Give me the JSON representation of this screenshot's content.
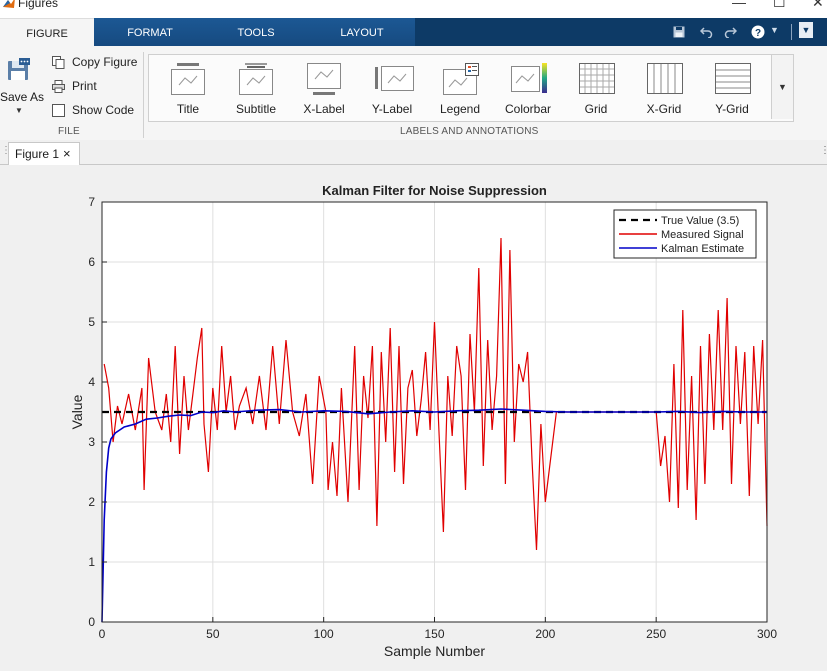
{
  "window": {
    "title": "Figures",
    "minimize_glyph": "—",
    "restore_glyph": "☐",
    "close_glyph": "✕"
  },
  "ribbon": {
    "tabs": [
      "FIGURE",
      "FORMAT",
      "TOOLS",
      "LAYOUT"
    ],
    "active_tab": "FIGURE",
    "file": {
      "section_label": "FILE",
      "save_as": "Save As",
      "copy_figure": "Copy Figure",
      "print": "Print",
      "show_code": "Show Code"
    },
    "annotations": {
      "section_label": "LABELS AND ANNOTATIONS",
      "buttons": [
        "Title",
        "Subtitle",
        "X-Label",
        "Y-Label",
        "Legend",
        "Colorbar",
        "Grid",
        "X-Grid",
        "Y-Grid"
      ]
    },
    "icons": [
      "save-icon",
      "undo-icon",
      "redo-icon",
      "help-icon",
      "dropdown-icon"
    ]
  },
  "doc_tabs": [
    {
      "label": "Figure 1",
      "close": "×"
    }
  ],
  "colors": {
    "ribbon_bar": "#1c5894",
    "measured": "#e00000",
    "estimate": "#0000c8",
    "true_value": "#000000"
  },
  "chart_data": {
    "type": "line",
    "title": "Kalman Filter for Noise Suppression",
    "xlabel": "Sample Number",
    "ylabel": "Value",
    "xlim": [
      0,
      300
    ],
    "ylim": [
      0,
      7
    ],
    "xticks": [
      0,
      50,
      100,
      150,
      200,
      250,
      300
    ],
    "yticks": [
      0,
      1,
      2,
      3,
      4,
      5,
      6,
      7
    ],
    "grid": true,
    "legend_position": "top-right",
    "series": [
      {
        "name": "True Value (3.5)",
        "style": "dashed",
        "color": "#000000",
        "x": [
          0,
          300
        ],
        "y": [
          3.5,
          3.5
        ]
      },
      {
        "name": "Measured Signal",
        "style": "solid",
        "color": "#e00000",
        "x": [
          1,
          3,
          5,
          7,
          9,
          12,
          15,
          18,
          19,
          21,
          24,
          27,
          29,
          31,
          33,
          35,
          37,
          39,
          41,
          43,
          45,
          46,
          48,
          50,
          52,
          54,
          56,
          58,
          60,
          62,
          65,
          68,
          71,
          74,
          77,
          80,
          83,
          86,
          89,
          92,
          95,
          98,
          101,
          102,
          104,
          106,
          108,
          111,
          114,
          116,
          118,
          120,
          122,
          124,
          126,
          128,
          130,
          132,
          134,
          136,
          138,
          140,
          142,
          144,
          146,
          148,
          150,
          152,
          154,
          156,
          158,
          160,
          162,
          164,
          166,
          168,
          170,
          172,
          174,
          176,
          178,
          180,
          182,
          184,
          186,
          188,
          190,
          192,
          194,
          196,
          198,
          200,
          205,
          210,
          215,
          220,
          225,
          230,
          235,
          240,
          245,
          250,
          252,
          254,
          256,
          258,
          260,
          262,
          264,
          266,
          268,
          270,
          272,
          274,
          276,
          278,
          280,
          282,
          284,
          286,
          288,
          290,
          292,
          294,
          296,
          298,
          300
        ],
        "y": [
          4.3,
          3.9,
          3.0,
          3.6,
          3.3,
          3.8,
          3.2,
          3.9,
          2.2,
          4.4,
          3.5,
          3.2,
          3.8,
          3.0,
          4.6,
          2.8,
          4.1,
          3.2,
          3.8,
          4.4,
          4.9,
          3.3,
          2.5,
          3.9,
          3.2,
          4.6,
          3.5,
          4.1,
          3.2,
          3.6,
          3.9,
          3.3,
          4.1,
          3.2,
          4.6,
          3.3,
          4.7,
          3.5,
          3.1,
          3.8,
          2.3,
          4.1,
          3.5,
          2.2,
          3.0,
          2.1,
          3.9,
          2.0,
          4.6,
          2.2,
          4.1,
          3.4,
          4.6,
          1.6,
          4.5,
          3.0,
          4.9,
          2.5,
          4.6,
          2.3,
          3.9,
          4.2,
          3.1,
          3.7,
          4.5,
          3.2,
          5.0,
          3.2,
          1.5,
          4.1,
          3.1,
          4.6,
          4.1,
          2.2,
          4.8,
          3.5,
          5.9,
          2.6,
          4.7,
          3.2,
          4.1,
          6.4,
          2.3,
          6.2,
          3.0,
          4.3,
          4.0,
          4.5,
          2.7,
          1.2,
          3.3,
          2.0,
          3.5,
          3.5,
          3.5,
          3.5,
          3.5,
          3.5,
          3.5,
          3.5,
          3.5,
          3.5,
          2.6,
          3.1,
          2.0,
          4.3,
          1.9,
          5.2,
          2.2,
          4.1,
          1.7,
          4.6,
          2.3,
          4.8,
          3.2,
          5.2,
          3.2,
          5.4,
          2.3,
          4.6,
          3.3,
          4.5,
          2.1,
          4.6,
          3.3,
          4.7,
          1.6
        ]
      },
      {
        "name": "Kalman Estimate",
        "style": "solid",
        "color": "#0000c8",
        "x": [
          0,
          1,
          2,
          3,
          4,
          6,
          8,
          10,
          15,
          20,
          25,
          30,
          35,
          40,
          45,
          50,
          55,
          60,
          70,
          80,
          90,
          100,
          110,
          120,
          130,
          140,
          150,
          160,
          170,
          180,
          190,
          200,
          210,
          220,
          230,
          240,
          250,
          260,
          270,
          280,
          290,
          300
        ],
        "y": [
          0,
          1.7,
          2.5,
          2.9,
          3.05,
          3.15,
          3.2,
          3.25,
          3.3,
          3.38,
          3.4,
          3.43,
          3.45,
          3.44,
          3.5,
          3.49,
          3.52,
          3.5,
          3.53,
          3.54,
          3.5,
          3.52,
          3.51,
          3.47,
          3.5,
          3.52,
          3.5,
          3.52,
          3.53,
          3.55,
          3.53,
          3.51,
          3.5,
          3.5,
          3.5,
          3.5,
          3.5,
          3.51,
          3.49,
          3.51,
          3.5,
          3.5
        ]
      }
    ]
  }
}
